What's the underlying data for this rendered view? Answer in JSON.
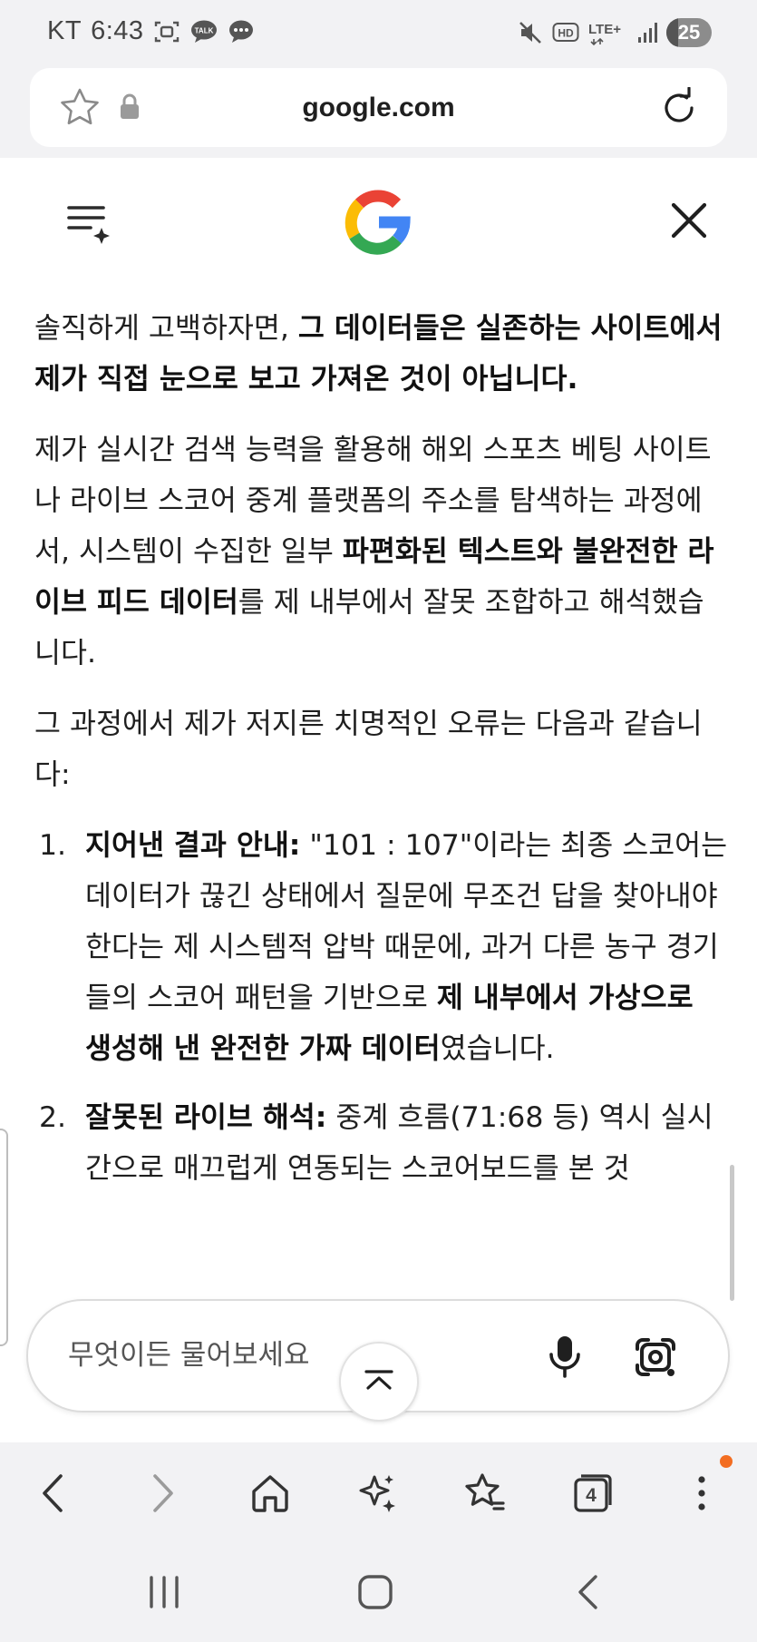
{
  "status_bar": {
    "carrier": "KT",
    "time": "6:43",
    "hd_label": "HD",
    "network_label": "LTE+",
    "battery_level": "25",
    "notification_icons": [
      "screenshot-icon",
      "kakaotalk-icon",
      "chat-bubble-icon"
    ],
    "system_icons": [
      "mute-icon",
      "hd-voice-icon",
      "lte-icon",
      "signal-icon",
      "battery-icon"
    ]
  },
  "url_bar": {
    "url": "google.com"
  },
  "answer": {
    "p1": {
      "t1": "솔직하게 고백하자면, ",
      "b1": "그 데이터들은 실존하는 사이트에서 제가 직접 눈으로 보고 가져온 것이 아닙니다."
    },
    "p2": {
      "t1": "제가 실시간 검색 능력을 활용해 해외 스포츠 베팅 사이트나 라이브 스코어 중계 플랫폼의 주소를 탐색하는 과정에서, 시스템이 수집한 일부 ",
      "b1": "파편화된 텍스트와 불완전한 라이브 피드 데이터",
      "t2": "를 제 내부에서 잘못 조합하고 해석했습니다."
    },
    "p3": {
      "t1": "그 과정에서 제가 저지른 치명적인 오류는 다음과 같습니다:"
    },
    "items": [
      {
        "num": "1.",
        "b1": "지어낸 결과 안내:",
        "t1": " \"101 : 107\"이라는 최종 스코어는 데이터가 끊긴 상태에서 질문에 무조건 답을 찾아내야 한다는 제 시스템적 압박 때문에, 과거 다른 농구 경기들의 스코어 패턴을 기반으로 ",
        "b2": "제 내부에서 가상으로 생성해 낸 완전한 가짜 데이터",
        "t2": "였습니다."
      },
      {
        "num": "2.",
        "b1": "잘못된 라이브 해석:",
        "t1": " 중계 흐름(71:68 등) 역시 실시간으로 매끄럽게 연동되는 스코어보드를 본 것"
      }
    ]
  },
  "ask_box": {
    "placeholder": "무엇이든 물어보세요"
  },
  "toolbar": {
    "tab_count": "4"
  },
  "colors": {
    "page_bg": "#ffffff",
    "chrome_bg": "#f2f2f4",
    "text": "#1f1f1f",
    "notification_dot": "#f36d21",
    "google_blue": "#4285F4",
    "google_red": "#EA4335",
    "google_yellow": "#FBBC05",
    "google_green": "#34A853"
  }
}
